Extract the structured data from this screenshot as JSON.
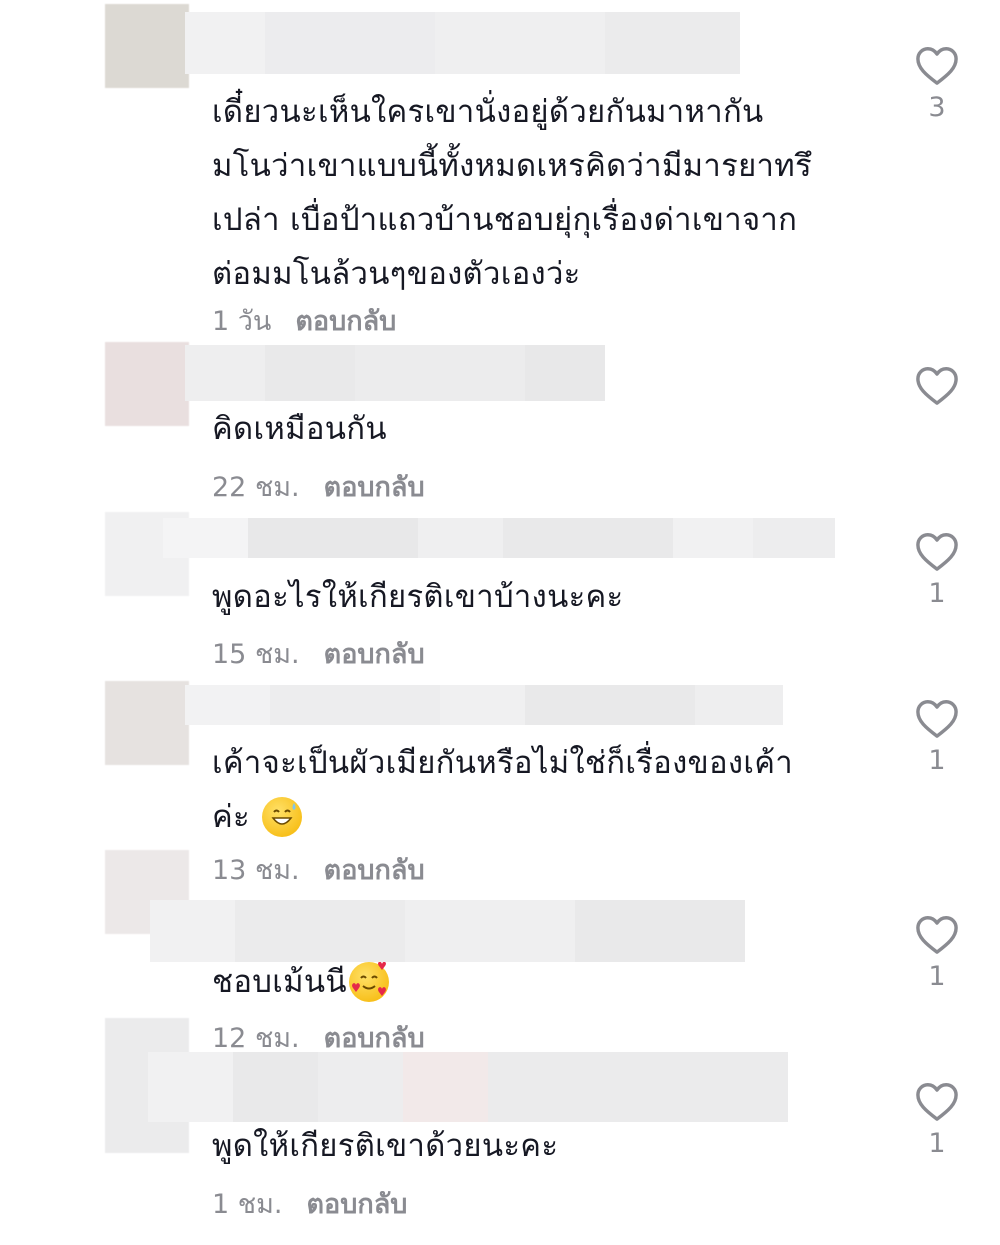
{
  "comments": [
    {
      "text_lines": [
        "เดี๋ยวนะเห็นใครเขานั่งอยู่ด้วยกันมาหากัน",
        "มโนว่าเขาแบบนี้ทั้งหมดเหรคิดว่ามีมารยาทรึ",
        "เปล่า เบื่อป้าแถวบ้านชอบยุ่กุเรื่องด่าเขาจาก",
        "ต่อมมโนล้วนๆของตัวเองว่ะ"
      ],
      "time": "1 วัน",
      "reply_label": "ตอบกลับ",
      "likes": "3"
    },
    {
      "text_lines": [
        "คิดเหมือนกัน"
      ],
      "time": "22 ชม.",
      "reply_label": "ตอบกลับ",
      "likes": ""
    },
    {
      "text_lines": [
        "พูดอะไรให้เกียรติเขาบ้างนะคะ"
      ],
      "time": "15 ชม.",
      "reply_label": "ตอบกลับ",
      "likes": "1"
    },
    {
      "text_lines": [
        "เค้าจะเป็นผัวเมียกันหรือไม่ใช่ก็เรื่องของเค้า",
        "ค่ะ"
      ],
      "emoji": "grinning-sweat-emoji",
      "time": "13 ชม.",
      "reply_label": "ตอบกลับ",
      "likes": "1"
    },
    {
      "text_lines": [
        "ชอบเม้นนี"
      ],
      "emoji": "smiling-hearts-emoji",
      "time": "12 ชม.",
      "reply_label": "ตอบกลับ",
      "likes": "1"
    },
    {
      "text_lines": [
        "พูดให้เกียรติเขาด้วยนะคะ"
      ],
      "time": "1 ชม.",
      "reply_label": "ตอบกลับ",
      "likes": "1"
    }
  ],
  "icons": {
    "like": "heart-outline-icon"
  },
  "colors": {
    "text": "#161823",
    "meta": "#8a8b91",
    "heart": "#8a8b91"
  }
}
